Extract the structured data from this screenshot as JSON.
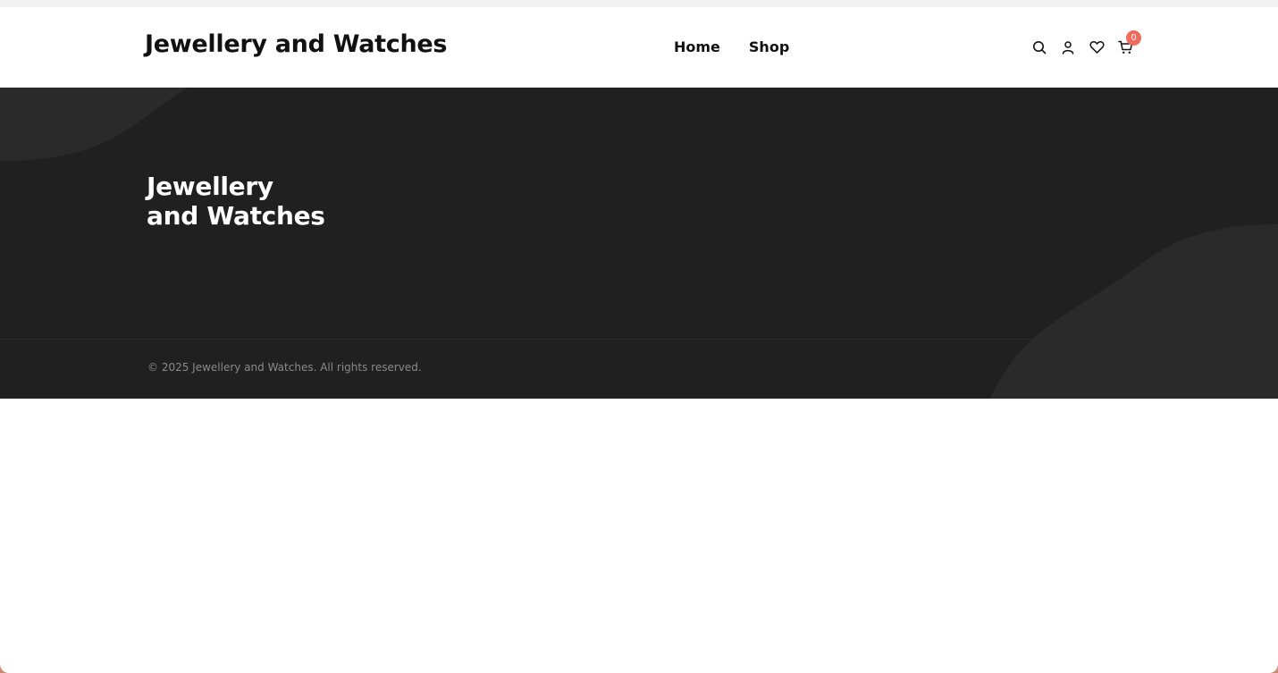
{
  "header": {
    "brand": "Jewellery and Watches",
    "nav": [
      {
        "label": "Home"
      },
      {
        "label": "Shop"
      }
    ],
    "icons": {
      "search": "search-icon",
      "account": "user-icon",
      "wishlist": "heart-icon",
      "cart": "cart-icon"
    },
    "cart_count": "0"
  },
  "hero": {
    "title": "Jewellery and Watches"
  },
  "footer": {
    "copyright": "© 2025 Jewellery and Watches. All rights reserved."
  },
  "colors": {
    "hero_background": "#202020",
    "badge": "#ef6b5c",
    "text_dark": "#111111"
  }
}
